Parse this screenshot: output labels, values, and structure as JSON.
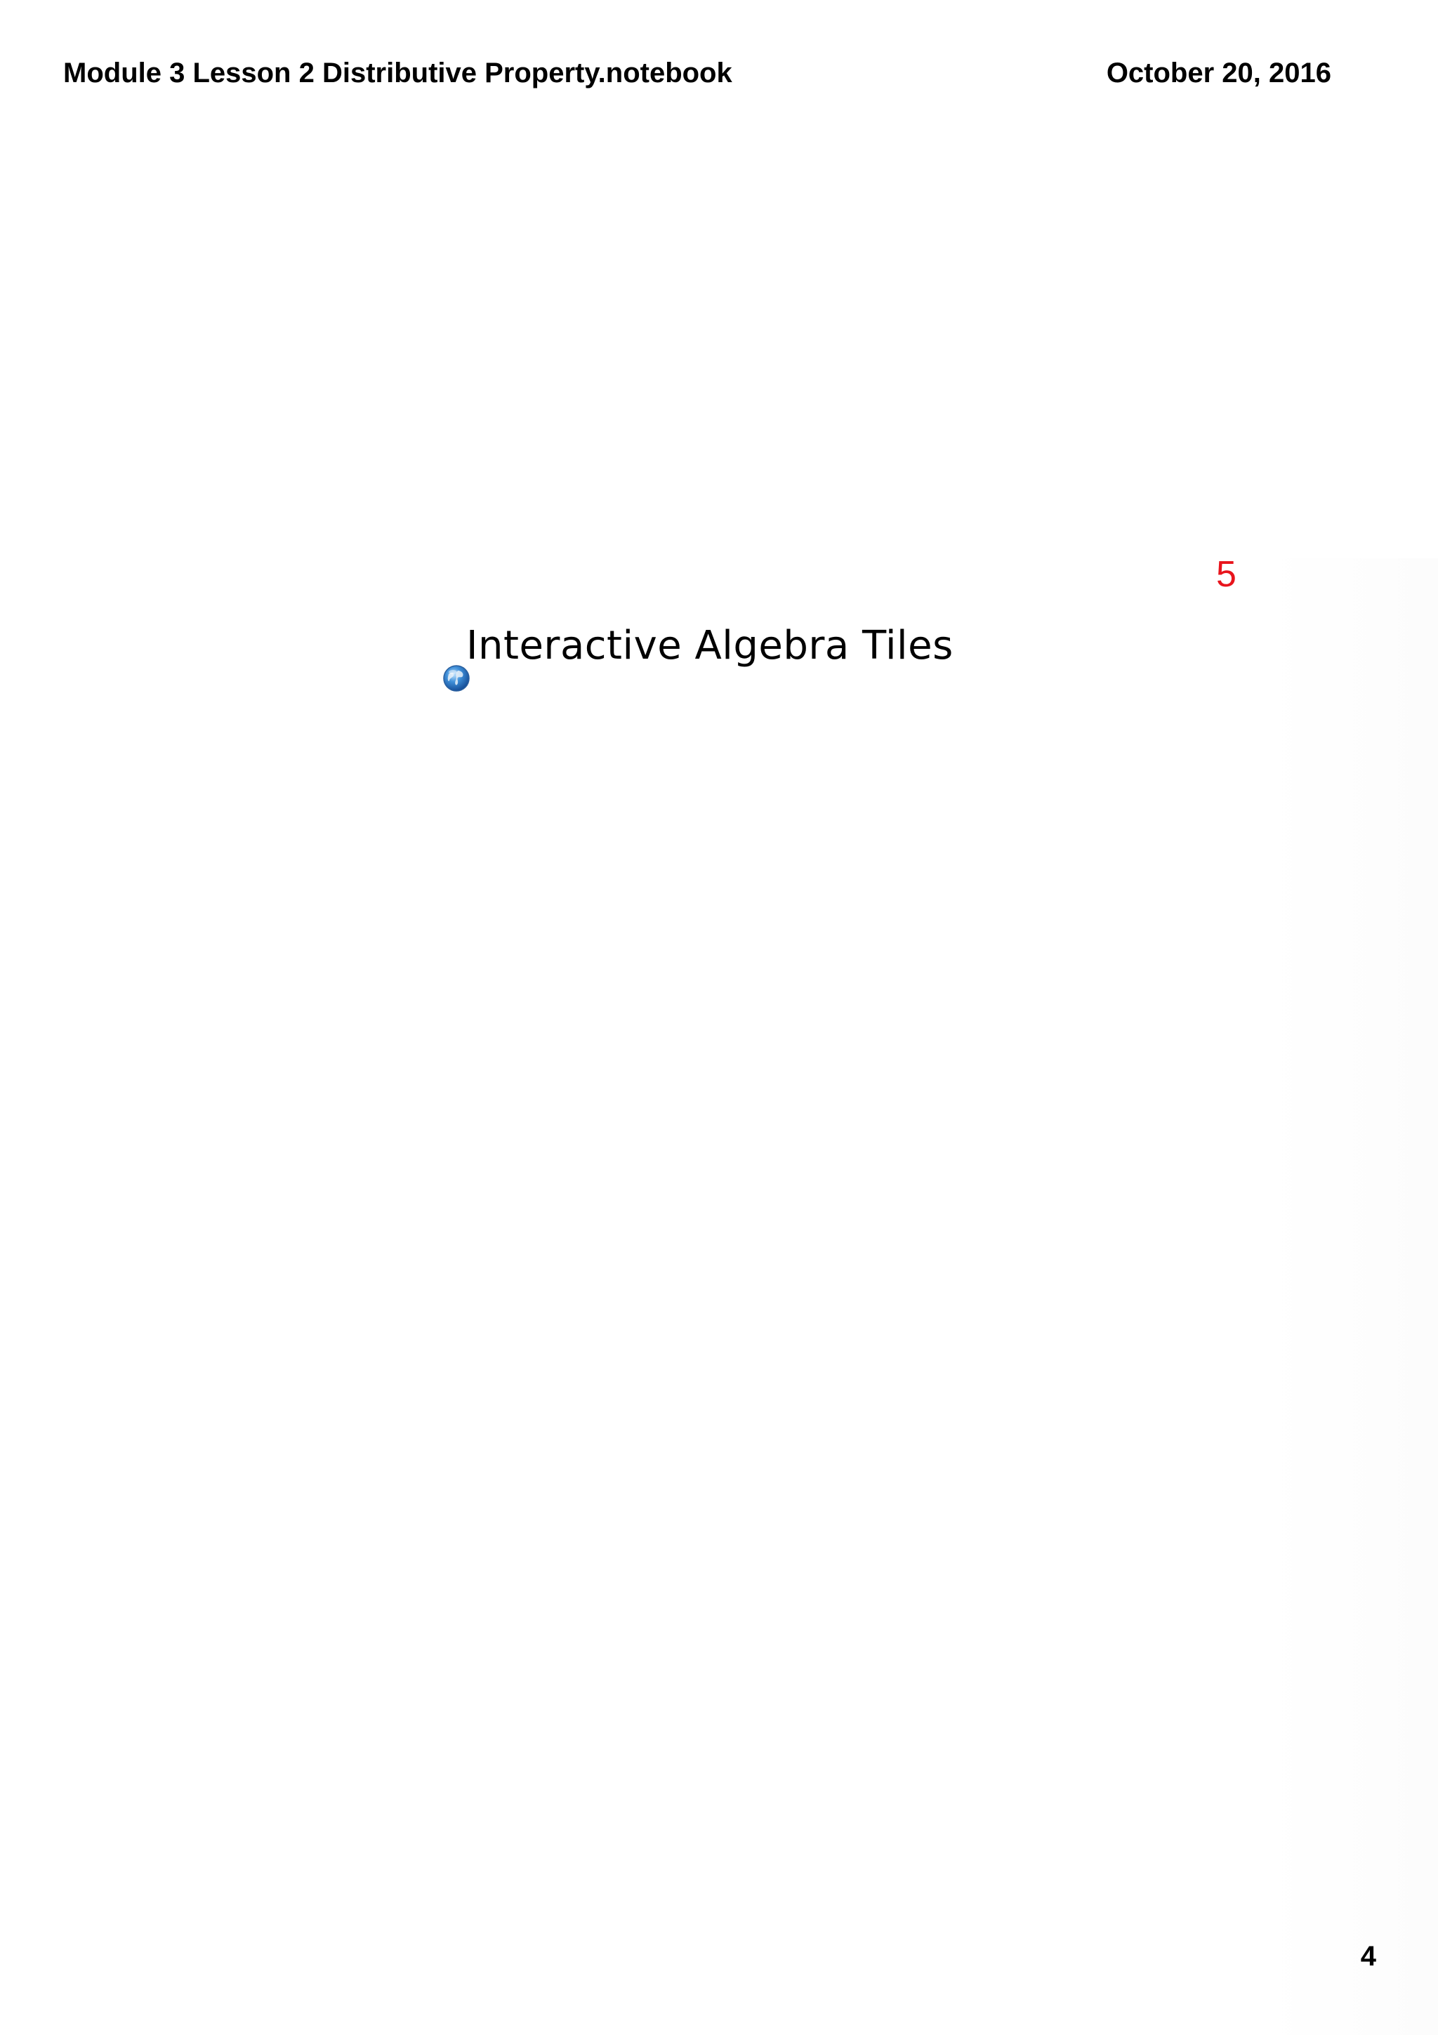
{
  "header": {
    "title": "Module 3 Lesson 2 Distributive Property.notebook",
    "date": "October 20, 2016"
  },
  "slide": {
    "number_label": "5",
    "number_color": "#e8141c",
    "link": {
      "icon": "globe-icon",
      "label": "Interactive Algebra Tiles"
    }
  },
  "footer": {
    "page_number": "4"
  }
}
